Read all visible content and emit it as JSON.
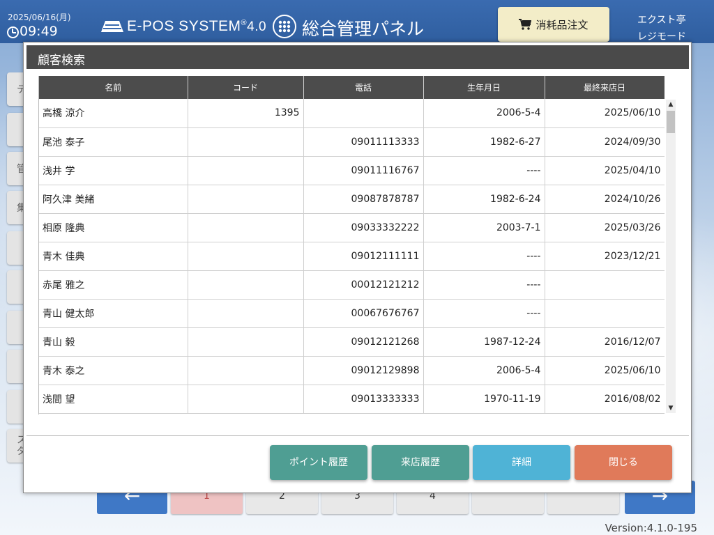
{
  "header": {
    "date": "2025/06/16(月)",
    "time": "09:49",
    "brand": "E-POS SYSTEM",
    "brand_reg": "®",
    "brand_version": "4.0",
    "panel_title": "総合管理パネル",
    "order_button": "消耗品注文",
    "store_name": "エクスト亭",
    "mode_label": "レジモード"
  },
  "side_buttons": [
    "テ",
    "",
    "管",
    "集",
    "",
    "",
    "",
    "",
    "",
    "ス\nダ"
  ],
  "pagination": {
    "pages": [
      "1",
      "2",
      "3",
      "4",
      "",
      ""
    ],
    "active_page": "1",
    "prev_arrow": "←",
    "next_arrow": "→"
  },
  "version": "Version:4.1.0-195",
  "modal": {
    "title": "顧客検索",
    "columns": [
      "名前",
      "コード",
      "電話",
      "生年月日",
      "最終来店日"
    ],
    "rows": [
      {
        "name": "高橋 涼介",
        "code": "1395",
        "phone": "",
        "birthday": "2006-5-4",
        "last_visit": "2025/06/10"
      },
      {
        "name": "尾池 泰子",
        "code": "",
        "phone": "09011113333",
        "birthday": "1982-6-27",
        "last_visit": "2024/09/30"
      },
      {
        "name": "浅井 学",
        "code": "",
        "phone": "09011116767",
        "birthday": "----",
        "last_visit": "2025/04/10"
      },
      {
        "name": "阿久津 美緒",
        "code": "",
        "phone": "09087878787",
        "birthday": "1982-6-24",
        "last_visit": "2024/10/26"
      },
      {
        "name": "相原 隆典",
        "code": "",
        "phone": "09033332222",
        "birthday": "2003-7-1",
        "last_visit": "2025/03/26"
      },
      {
        "name": "青木 佳典",
        "code": "",
        "phone": "09012111111",
        "birthday": "----",
        "last_visit": "2023/12/21"
      },
      {
        "name": "赤尾 雅之",
        "code": "",
        "phone": "00012121212",
        "birthday": "----",
        "last_visit": ""
      },
      {
        "name": "青山 健太郎",
        "code": "",
        "phone": "00067676767",
        "birthday": "----",
        "last_visit": ""
      },
      {
        "name": "青山 毅",
        "code": "",
        "phone": "09012121268",
        "birthday": "1987-12-24",
        "last_visit": "2016/12/07"
      },
      {
        "name": "青木 泰之",
        "code": "",
        "phone": "09012129898",
        "birthday": "2006-5-4",
        "last_visit": "2025/06/10"
      },
      {
        "name": "浅間 望",
        "code": "",
        "phone": "09013333333",
        "birthday": "1970-11-19",
        "last_visit": "2016/08/02"
      }
    ],
    "buttons": {
      "points_history": "ポイント履歴",
      "visit_history": "来店履歴",
      "details": "詳細",
      "close": "閉じる"
    },
    "button_colors": {
      "points_history": "#4f9e93",
      "visit_history": "#4f9e93",
      "details": "#4fb3d6",
      "close": "#e07a5a"
    }
  }
}
